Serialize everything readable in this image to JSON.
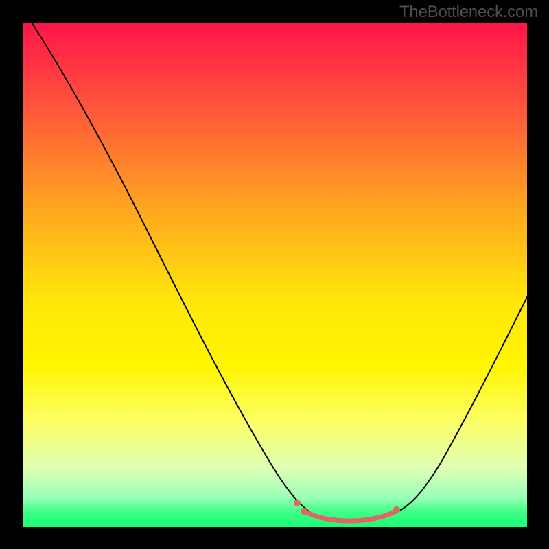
{
  "watermark": "TheBottleneck.com",
  "chart_data": {
    "type": "line",
    "title": "",
    "xlabel": "",
    "ylabel": "",
    "xlim": [
      0,
      100
    ],
    "ylim": [
      0,
      100
    ],
    "background_gradient": {
      "top_color": "#ff144a",
      "bottom_color": "#17ff74"
    },
    "series": [
      {
        "name": "bottleneck-curve",
        "x": [
          0,
          6,
          14,
          22,
          30,
          38,
          46,
          52,
          56,
          60,
          64,
          68,
          72,
          76,
          80,
          86,
          92,
          98,
          100
        ],
        "values": [
          110,
          98,
          85,
          72,
          58,
          43,
          27,
          14,
          6,
          2,
          1,
          1,
          2,
          4,
          9,
          20,
          34,
          50,
          55
        ]
      }
    ],
    "annotations": {
      "minimum_band": {
        "x_range": [
          56,
          74
        ],
        "y_level": 2,
        "note": "flat minimum region highlighted with colored markers"
      }
    },
    "colors": {
      "curve": "#000000",
      "markers": "#e06666"
    }
  }
}
